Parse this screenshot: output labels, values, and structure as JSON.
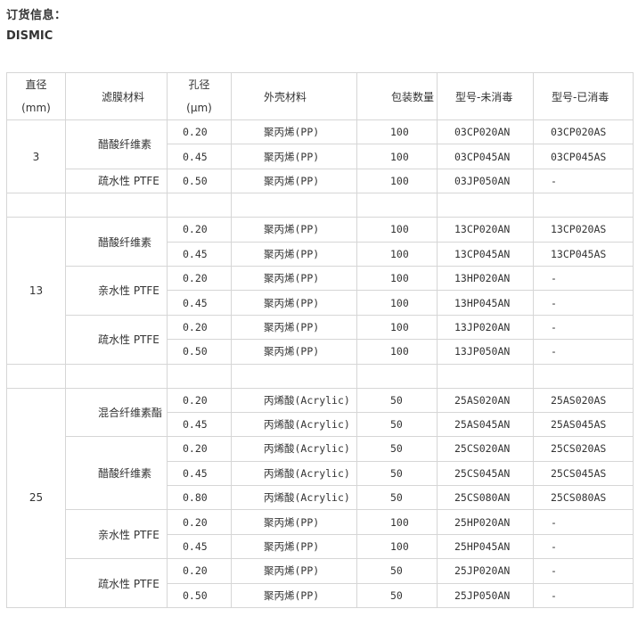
{
  "title": "订货信息：",
  "brand": "DISMIC",
  "headers": {
    "diameter_line1": "直径",
    "diameter_line2": "(mm)",
    "membrane": "滤膜材料",
    "pore_line1": "孔径",
    "pore_line2": "(μm)",
    "housing": "外壳材料",
    "qty": "包装数量",
    "model_nonsterile": "型号-未消毒",
    "model_sterile": "型号-已消毒"
  },
  "groups": [
    {
      "diameter": "3",
      "materials": [
        {
          "name": "醋酸纤维素",
          "rows": [
            {
              "pore": "0.20",
              "housing": "聚丙烯(PP)",
              "qty": "100",
              "nonsterile": "03CP020AN",
              "sterile": "03CP020AS"
            },
            {
              "pore": "0.45",
              "housing": "聚丙烯(PP)",
              "qty": "100",
              "nonsterile": "03CP045AN",
              "sterile": "03CP045AS"
            }
          ]
        },
        {
          "name": "疏水性 PTFE",
          "rows": [
            {
              "pore": "0.50",
              "housing": "聚丙烯(PP)",
              "qty": "100",
              "nonsterile": "03JP050AN",
              "sterile": "-"
            }
          ]
        }
      ]
    },
    {
      "diameter": "13",
      "materials": [
        {
          "name": "醋酸纤维素",
          "rows": [
            {
              "pore": "0.20",
              "housing": "聚丙烯(PP)",
              "qty": "100",
              "nonsterile": "13CP020AN",
              "sterile": "13CP020AS"
            },
            {
              "pore": "0.45",
              "housing": "聚丙烯(PP)",
              "qty": "100",
              "nonsterile": "13CP045AN",
              "sterile": "13CP045AS"
            }
          ]
        },
        {
          "name": "亲水性 PTFE",
          "rows": [
            {
              "pore": "0.20",
              "housing": "聚丙烯(PP)",
              "qty": "100",
              "nonsterile": "13HP020AN",
              "sterile": "-"
            },
            {
              "pore": "0.45",
              "housing": "聚丙烯(PP)",
              "qty": "100",
              "nonsterile": "13HP045AN",
              "sterile": "-"
            }
          ]
        },
        {
          "name": "疏水性 PTFE",
          "rows": [
            {
              "pore": "0.20",
              "housing": "聚丙烯(PP)",
              "qty": "100",
              "nonsterile": "13JP020AN",
              "sterile": "-"
            },
            {
              "pore": "0.50",
              "housing": "聚丙烯(PP)",
              "qty": "100",
              "nonsterile": "13JP050AN",
              "sterile": "-"
            }
          ]
        }
      ]
    },
    {
      "diameter": "25",
      "materials": [
        {
          "name": "混合纤维素酯",
          "rows": [
            {
              "pore": "0.20",
              "housing": "丙烯酸(Acrylic)",
              "qty": "50",
              "nonsterile": "25AS020AN",
              "sterile": "25AS020AS"
            },
            {
              "pore": "0.45",
              "housing": "丙烯酸(Acrylic)",
              "qty": "50",
              "nonsterile": "25AS045AN",
              "sterile": "25AS045AS"
            }
          ]
        },
        {
          "name": "醋酸纤维素",
          "rows": [
            {
              "pore": "0.20",
              "housing": "丙烯酸(Acrylic)",
              "qty": "50",
              "nonsterile": "25CS020AN",
              "sterile": "25CS020AS"
            },
            {
              "pore": "0.45",
              "housing": "丙烯酸(Acrylic)",
              "qty": "50",
              "nonsterile": "25CS045AN",
              "sterile": "25CS045AS"
            },
            {
              "pore": "0.80",
              "housing": "丙烯酸(Acrylic)",
              "qty": "50",
              "nonsterile": "25CS080AN",
              "sterile": "25CS080AS"
            }
          ]
        },
        {
          "name": "亲水性 PTFE",
          "rows": [
            {
              "pore": "0.20",
              "housing": "聚丙烯(PP)",
              "qty": "100",
              "nonsterile": "25HP020AN",
              "sterile": "-"
            },
            {
              "pore": "0.45",
              "housing": "聚丙烯(PP)",
              "qty": "100",
              "nonsterile": "25HP045AN",
              "sterile": "-"
            }
          ]
        },
        {
          "name": "疏水性 PTFE",
          "rows": [
            {
              "pore": "0.20",
              "housing": "聚丙烯(PP)",
              "qty": "50",
              "nonsterile": "25JP020AN",
              "sterile": "-"
            },
            {
              "pore": "0.50",
              "housing": "聚丙烯(PP)",
              "qty": "50",
              "nonsterile": "25JP050AN",
              "sterile": "-"
            }
          ]
        }
      ]
    }
  ]
}
